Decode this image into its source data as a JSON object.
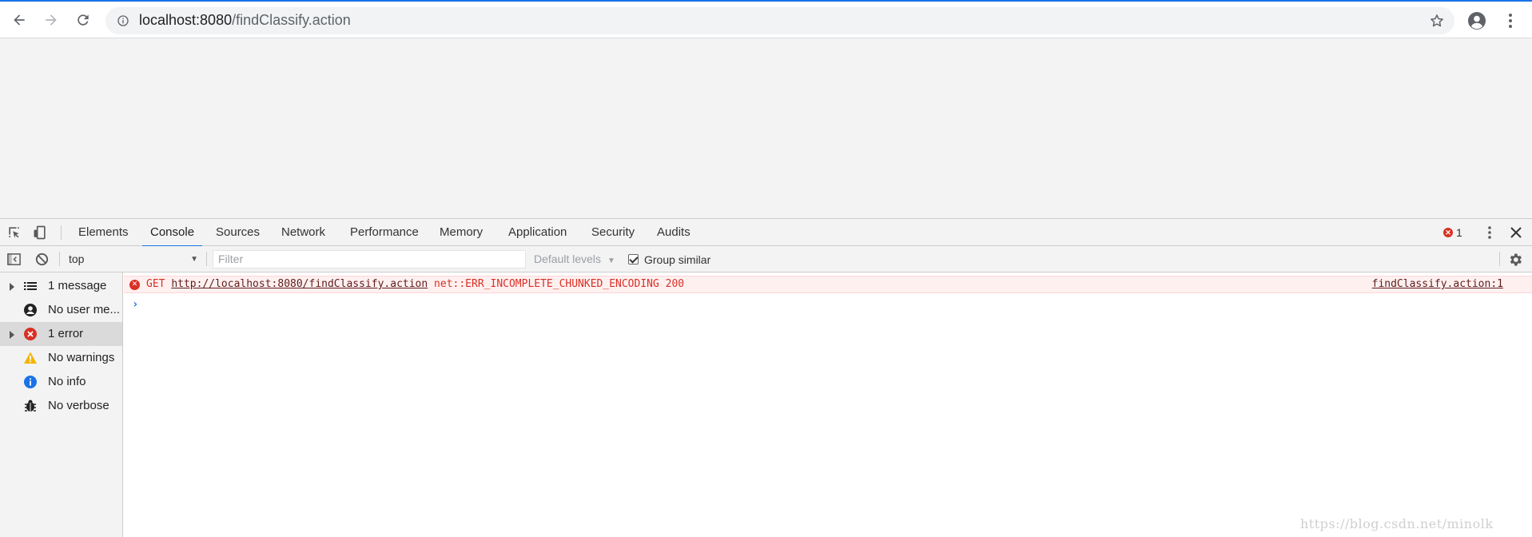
{
  "browser": {
    "url_host": "localhost:8080",
    "url_path": "/findClassify.action"
  },
  "devtools": {
    "tabs": [
      {
        "label": "Elements"
      },
      {
        "label": "Console",
        "active": true
      },
      {
        "label": "Sources"
      },
      {
        "label": "Network"
      },
      {
        "label": "Performance"
      },
      {
        "label": "Memory"
      },
      {
        "label": "Application"
      },
      {
        "label": "Security"
      },
      {
        "label": "Audits"
      }
    ],
    "error_count": "1",
    "context": "top",
    "filter_placeholder": "Filter",
    "levels_label": "Default levels",
    "group_similar_label": "Group similar",
    "group_similar_checked": true
  },
  "sidebar": {
    "items": [
      {
        "label": "1 message",
        "icon": "list-icon",
        "expandable": true
      },
      {
        "label": "No user me...",
        "icon": "user-icon",
        "expandable": false
      },
      {
        "label": "1 error",
        "icon": "error-icon",
        "expandable": true,
        "selected": true
      },
      {
        "label": "No warnings",
        "icon": "warning-icon",
        "expandable": false
      },
      {
        "label": "No info",
        "icon": "info-icon",
        "expandable": false
      },
      {
        "label": "No verbose",
        "icon": "bug-icon",
        "expandable": false
      }
    ]
  },
  "console": {
    "error": {
      "method": "GET",
      "url": "http://localhost:8080/findClassify.action",
      "message": "net::ERR_INCOMPLETE_CHUNKED_ENCODING 200",
      "source": "findClassify.action:1"
    },
    "prompt": "›"
  },
  "watermark": "https://blog.csdn.net/minolk",
  "colors": {
    "accent": "#1a73e8",
    "error": "#d93025",
    "error_bg": "#fff0f0",
    "viewport_bg": "#f3f3f3"
  }
}
